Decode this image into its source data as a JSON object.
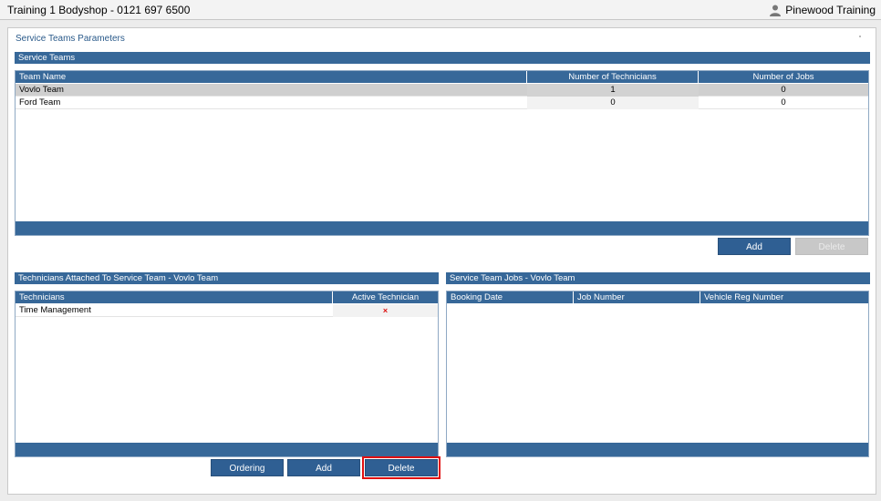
{
  "titlebar": {
    "app_title": "Training 1 Bodyshop - 0121 697 6500",
    "user_name": "Pinewood Training",
    "user_icon": "person-icon"
  },
  "panel": {
    "title": "Service Teams Parameters"
  },
  "service_teams": {
    "section_title": "Service Teams",
    "columns": [
      "Team Name",
      "Number of Technicians",
      "Number of Jobs"
    ],
    "rows": [
      {
        "name": "Vovlo Team",
        "technicians": "1",
        "jobs": "0",
        "selected": true
      },
      {
        "name": "Ford Team",
        "technicians": "0",
        "jobs": "0",
        "selected": false
      }
    ],
    "add_label": "Add",
    "delete_label": "Delete"
  },
  "technicians": {
    "section_title": "Technicians Attached To Service Team - Vovlo Team",
    "columns": [
      "Technicians",
      "Active Technician"
    ],
    "rows": [
      {
        "name": "Time Management",
        "active": "×"
      }
    ]
  },
  "jobs": {
    "section_title": "Service Team Jobs - Vovlo Team",
    "columns": [
      "Booking Date",
      "Job Number",
      "Vehicle Reg Number"
    ]
  },
  "bottom_buttons": {
    "ordering_label": "Ordering",
    "add_label": "Add",
    "delete_label": "Delete"
  }
}
